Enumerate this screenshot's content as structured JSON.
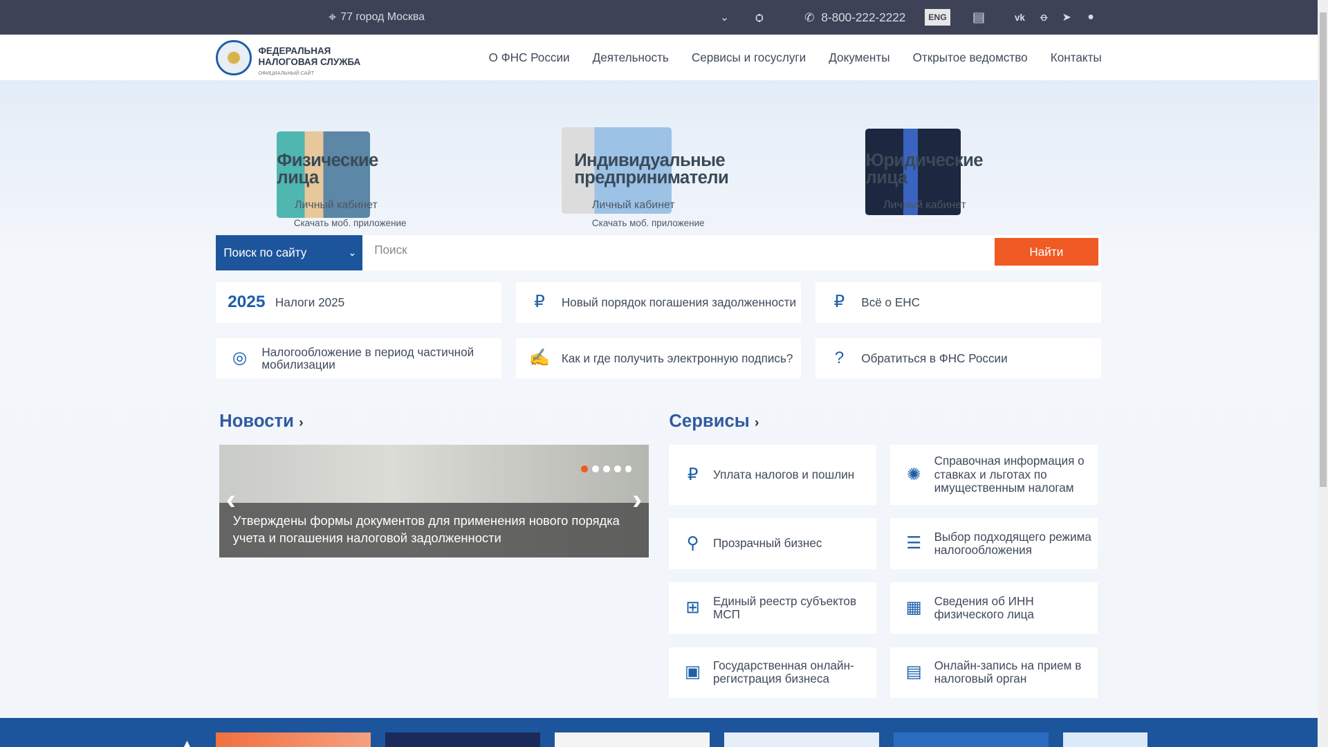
{
  "topbar": {
    "region": "77 город Москва",
    "phone": "8-800-222-2222",
    "lang": "ENG"
  },
  "logo": {
    "line1": "ФЕДЕРАЛЬНАЯ",
    "line2": "НАЛОГОВАЯ СЛУЖБА",
    "line3": "ОФИЦИАЛЬНЫЙ САЙТ"
  },
  "nav": [
    "О ФНС России",
    "Деятельность",
    "Сервисы и госуслуги",
    "Документы",
    "Открытое ведомство",
    "Контакты"
  ],
  "personas": [
    {
      "title1": "Физические",
      "title2": "лица",
      "cabinet": "Личный кабинет",
      "app": "Скачать моб. приложение"
    },
    {
      "title1": "Индивидуальные",
      "title2": "предприниматели",
      "cabinet": "Личный кабинет",
      "app": "Скачать моб. приложение"
    },
    {
      "title1": "Юридические",
      "title2": "лица",
      "cabinet": "Личный кабинет"
    }
  ],
  "search": {
    "scope": "Поиск по сайту",
    "placeholder": "Поиск",
    "button": "Найти"
  },
  "tiles": [
    "Налоги 2025",
    "Новый порядок погашения задолженности",
    "Всё о ЕНС",
    "Налогообложение в период частичной мобилизации",
    "Как и где получить электронную подпись?",
    "Обратиться в ФНС России"
  ],
  "tile_logo_2025": "2025",
  "news": {
    "title": "Новости",
    "caption": "Утверждены формы документов для применения нового порядка учета и погашения налоговой задолженности",
    "slides": 5,
    "active": 1
  },
  "services": {
    "title": "Сервисы",
    "items": [
      "Уплата налогов и пошлин",
      "Справочная информация о ставках и льготах по имущественным налогам",
      "Прозрачный бизнес",
      "Выбор подходящего режима налогообложения",
      "Единый реестр субъектов МСП",
      "Сведения об ИНН физического лица",
      "Государственная онлайн-регистрация бизнеса",
      "Онлайн-запись на прием в налоговый орган"
    ]
  },
  "colors": {
    "accent": "#f05a24",
    "brand": "#1d559c",
    "topbar": "#3d4256"
  }
}
